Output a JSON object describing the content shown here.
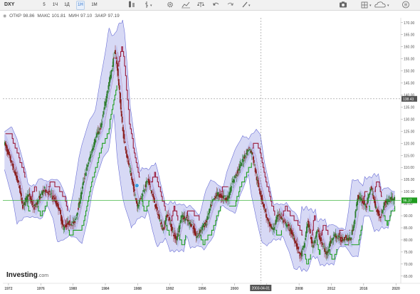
{
  "toolbar": {
    "symbol": "DXY",
    "timeframes": [
      "5",
      "1Ч",
      "1Д",
      "1Н",
      "1М"
    ],
    "active_timeframe_index": 3,
    "icons": [
      "settings-icon",
      "gear-icon",
      "chart-type-icon",
      "compare-icon",
      "undo-icon",
      "redo-icon",
      "draw-icon",
      "camera-icon",
      "layout-icon",
      "cloud-icon",
      "menu-icon"
    ]
  },
  "ohlc": {
    "open_label": "ОТКР",
    "open": "98.86",
    "high_label": "МАКС",
    "high": "101.81",
    "low_label": "МИН",
    "low": "97.10",
    "close_label": "ЗАКР",
    "close": "97.19"
  },
  "brand": {
    "name": "Investing",
    "suffix": ".com"
  },
  "colors": {
    "band_fill": "#c9ccf2",
    "band_line": "#6b6fd6",
    "bull": "#2f7d2f",
    "bear": "#8b2020",
    "trail_green": "#1fa01f",
    "trail_red": "#9a1a3a",
    "price_line": "#22aa22",
    "badge": "#1f9c1f"
  },
  "chart_data": {
    "type": "candlestick",
    "title": "",
    "x_ticks": [
      "1972",
      "1976",
      "1980",
      "1984",
      "1988",
      "1992",
      "1996",
      "2000",
      "2004",
      "2008",
      "2012",
      "2016",
      "2020"
    ],
    "y_ticks": [
      65,
      70,
      75,
      80,
      85,
      90,
      95,
      100,
      105,
      110,
      115,
      120,
      125,
      130,
      135,
      140,
      145,
      150,
      155,
      160,
      165,
      170
    ],
    "ylim": [
      62,
      172
    ],
    "xlim": [
      1971.3,
      2020.6
    ],
    "y_tick_labels": [
      "65.00",
      "70.00",
      "75.00",
      "80.00",
      "85.00",
      "90.00",
      "95.00",
      "100.00",
      "105.00",
      "110.00",
      "115.00",
      "120.00",
      "125.00",
      "130.00",
      "135.00",
      "140.00",
      "145.00",
      "150.00",
      "155.00",
      "160.00",
      "165.00",
      "170.00"
    ],
    "crosshair": {
      "x_label": "2003-04-01",
      "x": 2003.25,
      "y_label": "138.43",
      "y": 138.43
    },
    "last_price": {
      "label": "96.37",
      "value": 96.37
    },
    "alert_marker_x": 1987.9,
    "alert_marker_y": 102.5,
    "price_points": [
      [
        1971.5,
        120.5
      ],
      [
        1972.5,
        111
      ],
      [
        1973.3,
        103
      ],
      [
        1973.8,
        94
      ],
      [
        1974.5,
        99
      ],
      [
        1975.2,
        93
      ],
      [
        1975.8,
        97
      ],
      [
        1976.5,
        101
      ],
      [
        1977.5,
        98
      ],
      [
        1978.3,
        93
      ],
      [
        1978.8,
        85
      ],
      [
        1979.5,
        87
      ],
      [
        1980.2,
        87
      ],
      [
        1980.8,
        95
      ],
      [
        1981.5,
        107
      ],
      [
        1982.2,
        115
      ],
      [
        1982.8,
        122
      ],
      [
        1983.5,
        127
      ],
      [
        1984.2,
        140
      ],
      [
        1984.8,
        150
      ],
      [
        1985.2,
        158
      ],
      [
        1985.5,
        152
      ],
      [
        1986.2,
        125
      ],
      [
        1986.8,
        113
      ],
      [
        1987.5,
        102
      ],
      [
        1988.0,
        94
      ],
      [
        1988.6,
        99
      ],
      [
        1989.3,
        105
      ],
      [
        1990.0,
        97
      ],
      [
        1990.6,
        90
      ],
      [
        1991.2,
        84
      ],
      [
        1991.7,
        91
      ],
      [
        1992.3,
        84
      ],
      [
        1992.8,
        80
      ],
      [
        1993.5,
        90
      ],
      [
        1994.2,
        88
      ],
      [
        1994.8,
        86
      ],
      [
        1995.3,
        81
      ],
      [
        1995.8,
        84
      ],
      [
        1996.5,
        87
      ],
      [
        1997.2,
        95
      ],
      [
        1997.8,
        99
      ],
      [
        1998.5,
        98
      ],
      [
        1999.2,
        97
      ],
      [
        1999.8,
        104
      ],
      [
        2000.5,
        109
      ],
      [
        2001.2,
        114
      ],
      [
        2001.8,
        118
      ],
      [
        2002.3,
        115
      ],
      [
        2002.8,
        105
      ],
      [
        2003.5,
        96
      ],
      [
        2004.2,
        87
      ],
      [
        2004.8,
        84
      ],
      [
        2005.5,
        91
      ],
      [
        2006.2,
        87
      ],
      [
        2006.8,
        85
      ],
      [
        2007.5,
        80
      ],
      [
        2008.2,
        73
      ],
      [
        2008.7,
        78
      ],
      [
        2009.1,
        88
      ],
      [
        2009.7,
        77
      ],
      [
        2010.3,
        84
      ],
      [
        2010.9,
        78
      ],
      [
        2011.4,
        74
      ],
      [
        2011.9,
        79
      ],
      [
        2012.5,
        82
      ],
      [
        2013.2,
        80
      ],
      [
        2013.8,
        81
      ],
      [
        2014.4,
        80
      ],
      [
        2014.9,
        88
      ],
      [
        2015.3,
        98
      ],
      [
        2015.9,
        96
      ],
      [
        2016.4,
        94
      ],
      [
        2016.9,
        102
      ],
      [
        2017.5,
        94
      ],
      [
        2018.1,
        89
      ],
      [
        2018.6,
        95
      ],
      [
        2019.3,
        97
      ],
      [
        2019.8,
        97.2
      ]
    ]
  }
}
